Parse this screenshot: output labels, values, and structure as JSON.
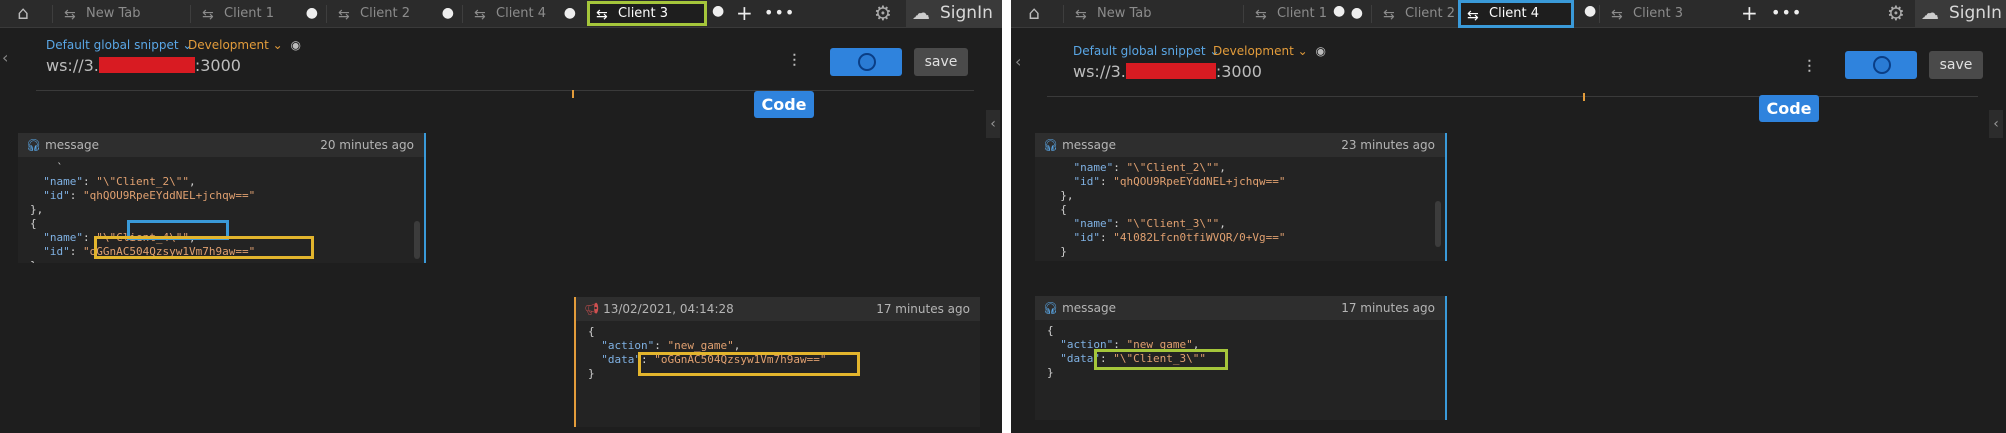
{
  "left": {
    "tabs": [
      {
        "label": "New Tab",
        "dirty": false
      },
      {
        "label": "Client 1",
        "dirty": true
      },
      {
        "label": "Client 2",
        "dirty": true
      },
      {
        "label": "Client 4",
        "dirty": true
      },
      {
        "label": "Client 3",
        "dirty": true
      }
    ],
    "active_tab": "Client 3",
    "signin": "SignIn",
    "snippet": "Default global snippet",
    "environment": "Development",
    "url_prefix": "ws://3.",
    "url_suffix": ":3000",
    "connect_toggle": "on",
    "save_label": "save",
    "code_label": "Code",
    "messages": [
      {
        "label": "message",
        "time": "20 minutes ago",
        "lines": [
          {
            "type": "plain",
            "text": "    `"
          },
          {
            "type": "kv",
            "indent": "  ",
            "key": "\"name\"",
            "value": "\"\\\"Client_2\\\"\"",
            "trail": ","
          },
          {
            "type": "kv",
            "indent": "  ",
            "key": "\"id\"",
            "value": "\"qhQOU9RpeEYddNEL+jchqw==\"",
            "trail": ""
          },
          {
            "type": "plain",
            "text": "},"
          },
          {
            "type": "plain",
            "text": "{"
          },
          {
            "type": "kv",
            "indent": "  ",
            "key": "\"name\"",
            "value": "\"\\\"Client_4\\\"\"",
            "trail": ","
          },
          {
            "type": "kv",
            "indent": "  ",
            "key": "\"id\"",
            "value": "\"oGGnAC504Qzsyw1Vm7h9aw==\"",
            "trail": ""
          },
          {
            "type": "plain",
            "text": "}"
          }
        ]
      },
      {
        "label": "13/02/2021, 04:14:28",
        "time": "17 minutes ago",
        "lines": [
          {
            "type": "plain",
            "text": "{"
          },
          {
            "type": "kv",
            "indent": "  ",
            "key": "\"action\"",
            "value": "\"new_game\"",
            "trail": ","
          },
          {
            "type": "kv",
            "indent": "  ",
            "key": "\"data\"",
            "value": "\"oGGnAC504Qzsyw1Vm7h9aw==\"",
            "trail": ""
          },
          {
            "type": "plain",
            "text": "}"
          }
        ]
      }
    ]
  },
  "right": {
    "tabs": [
      {
        "label": "New Tab",
        "dirty": false
      },
      {
        "label": "Client 1",
        "dirty": true
      },
      {
        "label": "Client 2",
        "dirty": true
      },
      {
        "label": "Client 4",
        "dirty": true
      },
      {
        "label": "Client 3",
        "dirty": false
      }
    ],
    "active_tab": "Client 4",
    "signin": "SignIn",
    "snippet": "Default global snippet",
    "environment": "Development",
    "url_prefix": "ws://3.",
    "url_suffix": ":3000",
    "connect_toggle": "on",
    "save_label": "save",
    "code_label": "Code",
    "messages": [
      {
        "label": "message",
        "time": "23 minutes ago",
        "lines": [
          {
            "type": "kv",
            "indent": "    ",
            "key": "\"name\"",
            "value": "\"\\\"Client_2\\\"\"",
            "trail": ","
          },
          {
            "type": "kv",
            "indent": "    ",
            "key": "\"id\"",
            "value": "\"qhQOU9RpeEYddNEL+jchqw==\"",
            "trail": ""
          },
          {
            "type": "plain",
            "text": "  },"
          },
          {
            "type": "plain",
            "text": "  {"
          },
          {
            "type": "kv",
            "indent": "    ",
            "key": "\"name\"",
            "value": "\"\\\"Client_3\\\"\"",
            "trail": ","
          },
          {
            "type": "kv",
            "indent": "    ",
            "key": "\"id\"",
            "value": "\"4l082Lfcn0tfiWVQR/0+Vg==\"",
            "trail": ""
          },
          {
            "type": "plain",
            "text": "  }"
          }
        ]
      },
      {
        "label": "message",
        "time": "17 minutes ago",
        "lines": [
          {
            "type": "plain",
            "text": "{"
          },
          {
            "type": "kv",
            "indent": "  ",
            "key": "\"action\"",
            "value": "\"new_game\"",
            "trail": ","
          },
          {
            "type": "kv",
            "indent": "  ",
            "key": "\"data\"",
            "value": "\"\\\"Client_3\\\"\"",
            "trail": ""
          },
          {
            "type": "plain",
            "text": "}"
          }
        ]
      }
    ]
  },
  "colors": {
    "highlight_green": "#a5c63b",
    "highlight_blue": "#3a9ad9",
    "highlight_yellow": "#e3b52d",
    "accent_blue": "#2f83dd",
    "env_orange": "#e39c3b"
  }
}
